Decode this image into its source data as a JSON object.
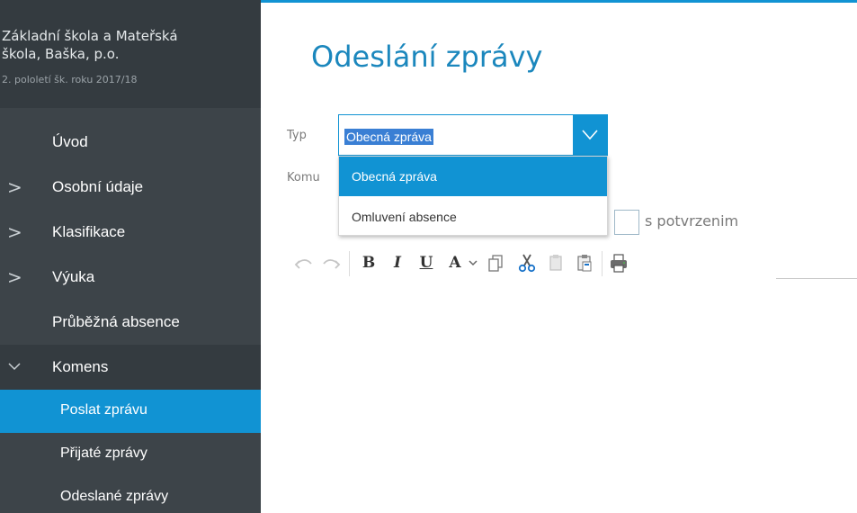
{
  "school": {
    "name_line1": "Základní škola a Mateřská",
    "name_line2": "škola, Baška, p.o.",
    "term": "2. pololetí šk. roku 2017/18"
  },
  "nav": {
    "intro": "Úvod",
    "personal": "Osobní údaje",
    "grading": "Klasifikace",
    "teaching": "Výuka",
    "absence": "Průběžná absence",
    "komens": "Komens",
    "send_message": "Poslat zprávu",
    "received": "Přijaté zprávy",
    "sent": "Odeslané zprávy"
  },
  "page": {
    "title": "Odeslání zprávy"
  },
  "form": {
    "type_label": "Typ",
    "to_label": "Komu",
    "type_value": "Obecná zpráva",
    "options": [
      "Obecná zpráva",
      "Omluvení absence"
    ],
    "confirm_label": "s potvrzenim"
  },
  "toolbar": {
    "bold": "B",
    "italic": "I",
    "underline": "U",
    "font_color": "A",
    "icons": [
      "undo-icon",
      "redo-icon",
      "copy-icon",
      "cut-icon",
      "paste-icon",
      "paste-word-icon",
      "print-icon",
      "chevron-down-icon"
    ]
  },
  "colors": {
    "accent": "#1193d3",
    "sidebar": "#3d4449",
    "title": "#1b87bd"
  }
}
